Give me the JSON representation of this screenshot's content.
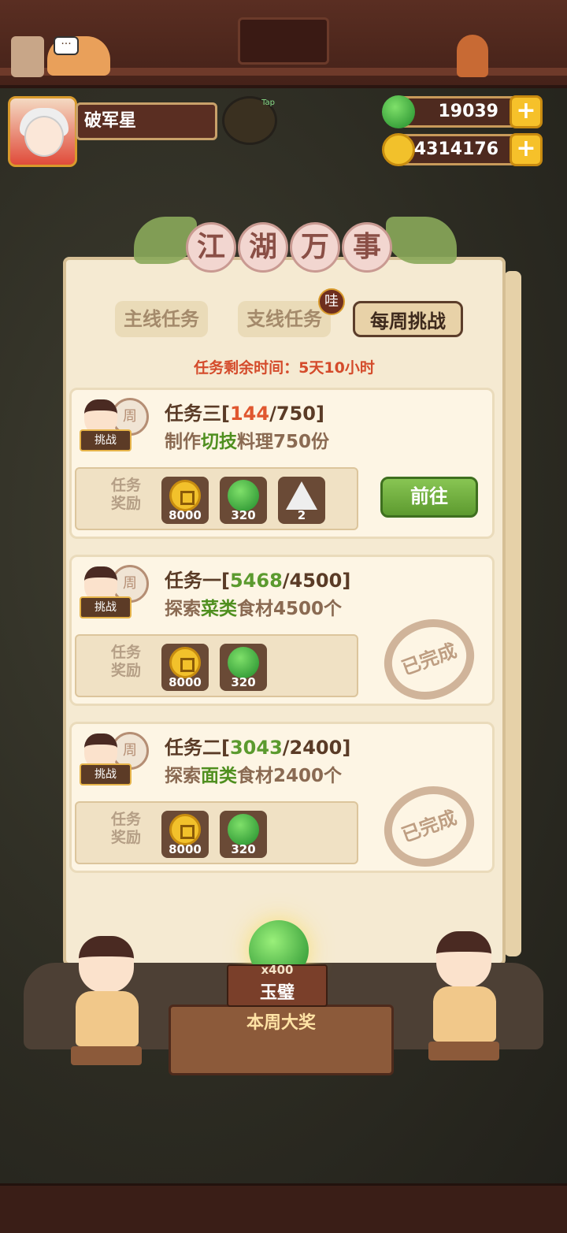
{
  "player": {
    "name": "破军星",
    "tap_hint": "Tap"
  },
  "currencies": [
    {
      "icon": "jade-icon",
      "value": "19039"
    },
    {
      "icon": "coin-icon",
      "value": "4314176"
    }
  ],
  "title": [
    "江",
    "湖",
    "万",
    "事"
  ],
  "tabs": [
    {
      "label": "主线任务",
      "active": false
    },
    {
      "label": "支线任务",
      "active": false,
      "badge": "哇"
    },
    {
      "label": "每周挑战",
      "active": true
    }
  ],
  "timer": "任务剩余时间：5天10小时",
  "reward_label": "任务奖励",
  "challenge_label": "挑战",
  "drum_char": "周",
  "go_button": "前往",
  "done_stamp": "已完成",
  "quests": [
    {
      "name": "任务三",
      "bracket_open": "[",
      "progress": "144",
      "sep": "/",
      "target": "750",
      "bracket_close": "]",
      "desc_pre": "制作",
      "desc_hl": "切技",
      "desc_post": "料理750份",
      "rewards": [
        {
          "icon": "coin-icon",
          "count": "8000"
        },
        {
          "icon": "jade-icon",
          "count": "320"
        },
        {
          "icon": "onigiri-icon",
          "count": "2"
        }
      ],
      "status": "in-progress"
    },
    {
      "name": "任务一",
      "bracket_open": "[",
      "progress": "5468",
      "sep": "/",
      "target": "4500",
      "bracket_close": "]",
      "desc_pre": "探索",
      "desc_hl": "菜类",
      "desc_post": "食材4500个",
      "rewards": [
        {
          "icon": "coin-icon",
          "count": "8000"
        },
        {
          "icon": "jade-icon",
          "count": "320"
        }
      ],
      "status": "done"
    },
    {
      "name": "任务二",
      "bracket_open": "[",
      "progress": "3043",
      "sep": "/",
      "target": "2400",
      "bracket_close": "]",
      "desc_pre": "探索",
      "desc_hl": "面类",
      "desc_post": "食材2400个",
      "rewards": [
        {
          "icon": "coin-icon",
          "count": "8000"
        },
        {
          "icon": "jade-icon",
          "count": "320"
        }
      ],
      "status": "done"
    }
  ],
  "grand_prize": {
    "count": "x400",
    "name": "玉璧",
    "label": "本周大奖"
  },
  "colors": {
    "accent_red": "#d44b2b",
    "accent_green": "#5b9a2e",
    "button_green": "#6aa83a"
  }
}
